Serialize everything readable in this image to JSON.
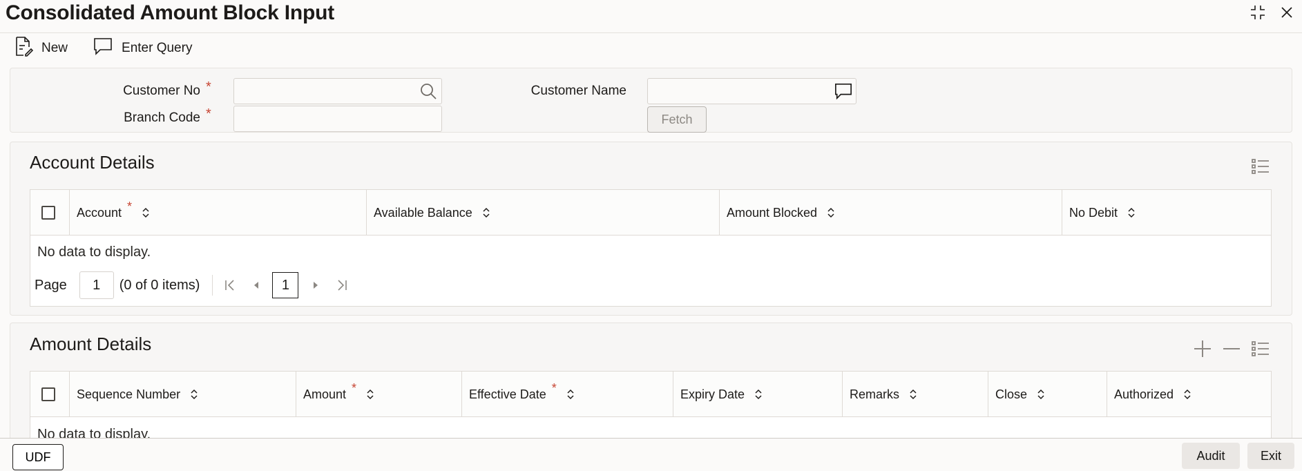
{
  "window": {
    "title": "Consolidated Amount Block Input"
  },
  "toolbar": {
    "new_label": "New",
    "enter_query_label": "Enter Query"
  },
  "form": {
    "customer_no_label": "Customer No",
    "customer_no_value": "",
    "branch_code_label": "Branch Code",
    "branch_code_value": "",
    "customer_name_label": "Customer Name",
    "customer_name_value": "",
    "required_mark": "*",
    "fetch_label": "Fetch"
  },
  "account_details": {
    "title": "Account Details",
    "columns": [
      "Account",
      "Available Balance",
      "Amount Blocked",
      "No Debit"
    ],
    "empty_text": "No data to display.",
    "pager": {
      "page_label": "Page",
      "page_value": "1",
      "items_text": "(0 of 0 items)",
      "current_page": "1"
    }
  },
  "amount_details": {
    "title": "Amount Details",
    "columns": [
      "Sequence Number",
      "Amount",
      "Effective Date",
      "Expiry Date",
      "Remarks",
      "Close",
      "Authorized"
    ],
    "empty_text": "No data to display."
  },
  "footer": {
    "udf_label": "UDF",
    "audit_label": "Audit",
    "exit_label": "Exit"
  }
}
